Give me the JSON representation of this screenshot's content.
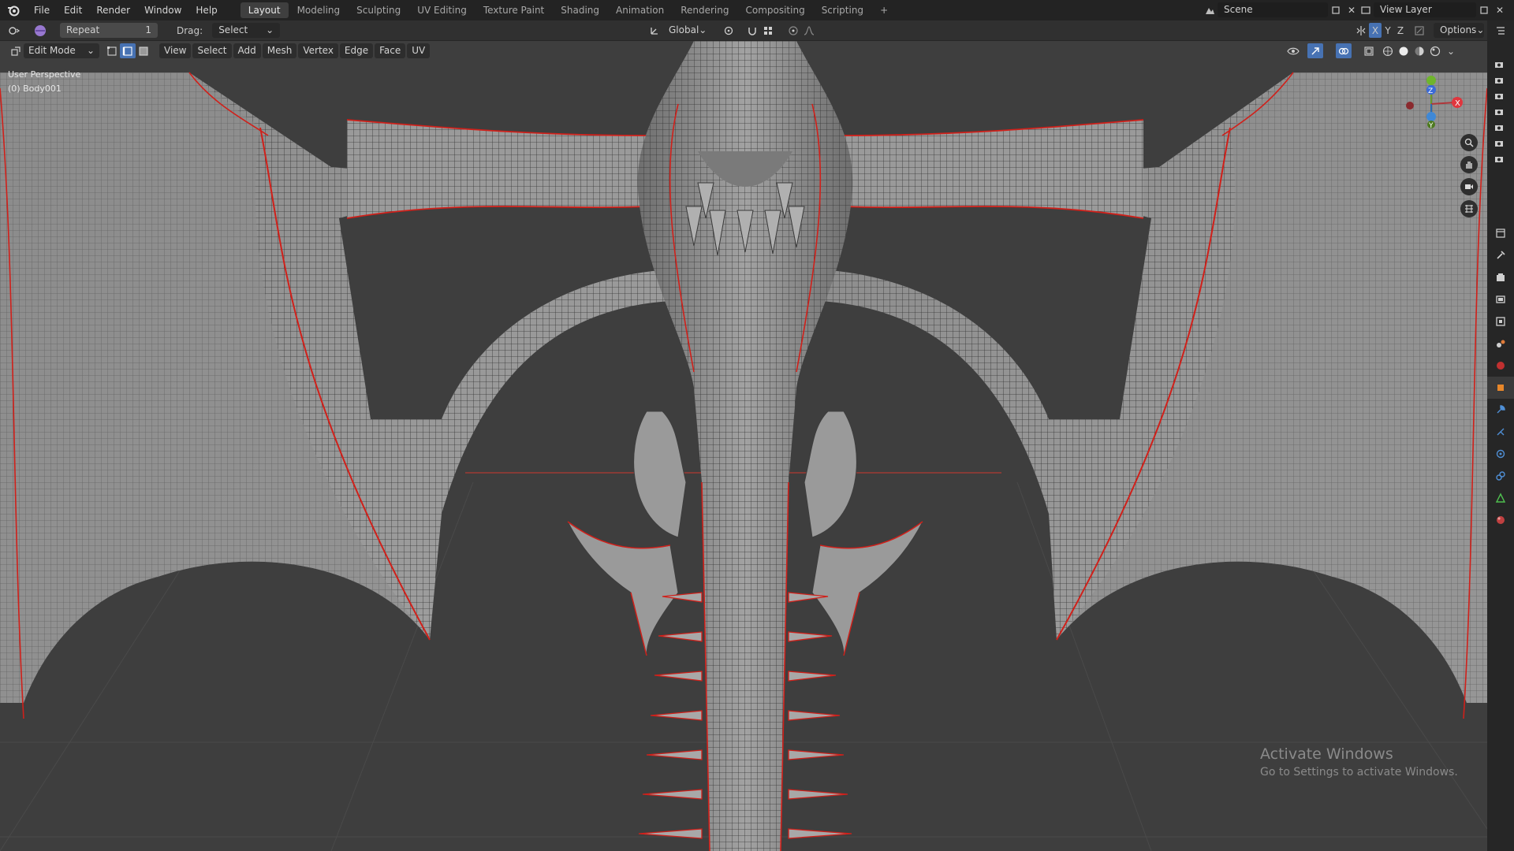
{
  "topbar": {
    "menus": [
      "File",
      "Edit",
      "Render",
      "Window",
      "Help"
    ],
    "workspaces": [
      "Layout",
      "Modeling",
      "Sculpting",
      "UV Editing",
      "Texture Paint",
      "Shading",
      "Animation",
      "Rendering",
      "Compositing",
      "Scripting"
    ],
    "active_workspace": "Layout",
    "add_tab": "+",
    "scene_name": "Scene",
    "view_layer": "View Layer"
  },
  "toolsettings": {
    "repeat_label": "Repeat",
    "repeat_count": "1",
    "drag_label": "Drag:",
    "drag_value": "Select Box",
    "orientation": "Global",
    "axis_x": "X",
    "axis_y": "Y",
    "axis_z": "Z",
    "options_label": "Options"
  },
  "viewport_header": {
    "mode": "Edit Mode",
    "menus": [
      "View",
      "Select",
      "Add",
      "Mesh",
      "Vertex",
      "Edge",
      "Face",
      "UV"
    ]
  },
  "viewport": {
    "perspective_label": "User Perspective",
    "object_label": "(0) Body001"
  },
  "gizmo": {
    "x": "X",
    "y": "Y",
    "z": "Z"
  },
  "watermark": {
    "title": "Activate Windows",
    "subtitle": "Go to Settings to activate Windows."
  },
  "colors": {
    "seam_red": "#d0201a",
    "mesh_grey": "#8e8e8e",
    "accent_blue": "#4772b3"
  }
}
